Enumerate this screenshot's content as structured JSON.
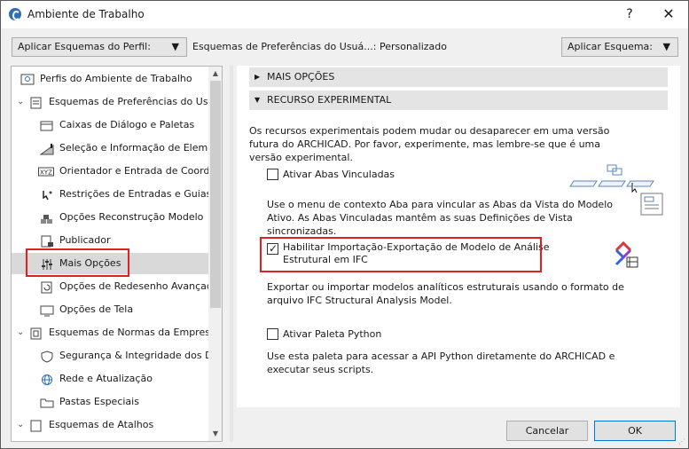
{
  "window": {
    "title": "Ambiente de Trabalho",
    "help_symbol": "?",
    "close_symbol": "✕"
  },
  "toolbar": {
    "profile_combo_label": "Aplicar Esquemas do Perfil:",
    "scheme_status": "Esquemas de Preferências do Usuá...: Personalizado",
    "apply_combo_label": "Aplicar Esquema:",
    "combo_arrow": "▼"
  },
  "tree": {
    "items": [
      {
        "label": "Perfis do Ambiente de Trabalho",
        "icon": "profile-icon",
        "caret": ""
      },
      {
        "label": "Esquemas de Preferências do Usuá",
        "icon": "user-prefs-icon",
        "caret": "⌄"
      },
      {
        "label": "Caixas de Diálogo e Paletas",
        "icon": "dialog-icon",
        "caret": ""
      },
      {
        "label": "Seleção e Informação de Element",
        "icon": "selection-icon",
        "caret": ""
      },
      {
        "label": "Orientador e Entrada de Coorder",
        "icon": "xyz-icon",
        "caret": ""
      },
      {
        "label": "Restrições de Entradas e Guias",
        "icon": "constraint-icon",
        "caret": ""
      },
      {
        "label": "Opções Reconstrução Modelo",
        "icon": "rebuild-icon",
        "caret": ""
      },
      {
        "label": "Publicador",
        "icon": "publisher-icon",
        "caret": ""
      },
      {
        "label": "Mais Opções",
        "icon": "sliders-icon",
        "caret": ""
      },
      {
        "label": "Opções de Redesenho Avançada",
        "icon": "redraw-icon",
        "caret": ""
      },
      {
        "label": "Opções de Tela",
        "icon": "screen-icon",
        "caret": ""
      },
      {
        "label": "Esquemas de Normas da Empresa",
        "icon": "company-icon",
        "caret": "⌄"
      },
      {
        "label": "Segurança & Integridade dos Da",
        "icon": "security-icon",
        "caret": ""
      },
      {
        "label": "Rede e Atualização",
        "icon": "network-icon",
        "caret": ""
      },
      {
        "label": "Pastas Especiais",
        "icon": "folder-icon",
        "caret": ""
      },
      {
        "label": "Esquemas de Atalhos",
        "icon": "shortcut-icon",
        "caret": "⌄"
      }
    ]
  },
  "panel": {
    "section_more_options": "MAIS OPÇÕES",
    "section_experimental": "RECURSO EXPERIMENTAL",
    "collapsed_triangle": "▶",
    "expanded_triangle": "▼",
    "intro_text": "Os recursos experimentais podem mudar ou desaparecer em uma versão futura do ARCHICAD. Por favor, experimente, mas lembre-se que é uma versão experimental.",
    "option_linked_tabs": {
      "label": "Ativar Abas Vinculadas",
      "checked": false,
      "description": "Use o menu de contexto Aba para vincular as Abas da Vista do Modelo Ativo. As Abas Vinculadas mantêm as suas Definições de Vista sincronizadas."
    },
    "option_ifc": {
      "label_line1": "Habilitar Importação-Exportação de Modelo de Análise",
      "label_line2": "Estrutural em IFC",
      "checked": true,
      "description": "Exportar ou importar modelos analíticos estruturais usando o formato de arquivo IFC Structural Analysis Model."
    },
    "option_python": {
      "label": "Ativar Paleta Python",
      "checked": false,
      "description": "Use esta paleta para acessar a API Python diretamente do ARCHICAD e executar seus scripts."
    }
  },
  "buttons": {
    "cancel": "Cancelar",
    "ok": "OK"
  },
  "colors": {
    "highlight": "#e02020",
    "ok_border": "#0078d7"
  }
}
